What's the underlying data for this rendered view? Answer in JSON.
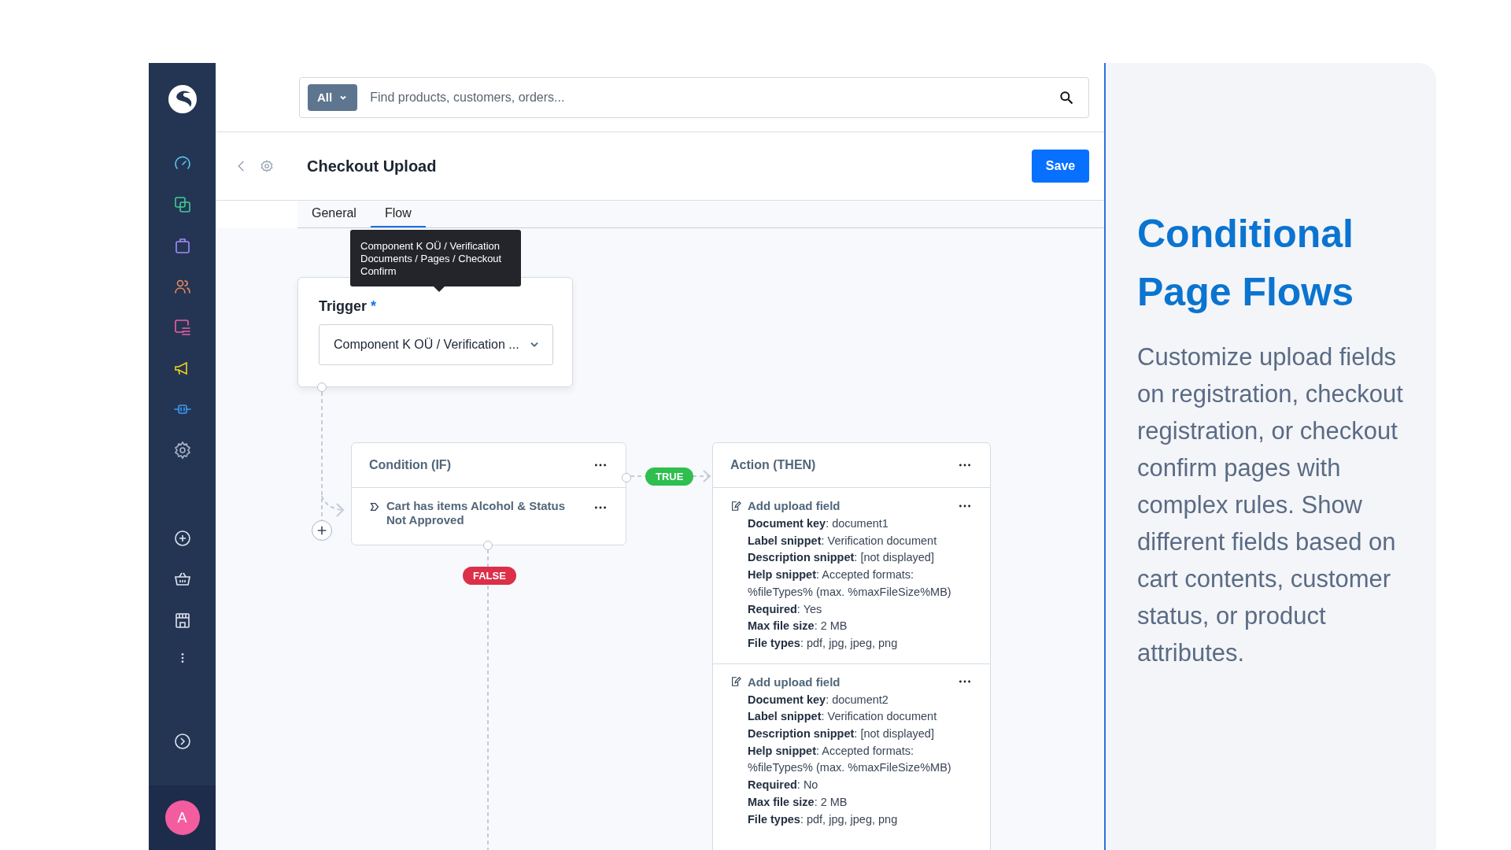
{
  "sidebar": {
    "avatar": "A"
  },
  "search": {
    "filter": "All",
    "placeholder": "Find products, customers, orders..."
  },
  "header": {
    "title": "Checkout Upload",
    "save": "Save"
  },
  "tabs": [
    {
      "label": "General",
      "selected": false
    },
    {
      "label": "Flow",
      "selected": true
    }
  ],
  "tooltip": "Component K OÜ / Verification Documents / Pages / Checkout Confirm",
  "trigger": {
    "label": "Trigger",
    "required": "*",
    "value": "Component K OÜ / Verification ..."
  },
  "condition": {
    "title": "Condition (IF)",
    "rule": "Cart has items Alcohol & Status Not Approved"
  },
  "branches": {
    "true": "TRUE",
    "false": "FALSE"
  },
  "action": {
    "title": "Action (THEN)",
    "items": [
      {
        "title": "Add upload field",
        "lines": [
          "**Document key**: document1",
          "**Label snippet**: Verification document",
          "**Description snippet**: [not displayed]",
          "**Help snippet**: Accepted formats: %fileTypes% (max. %maxFileSize%MB)",
          "**Required**: Yes",
          "**Max file size**: 2 MB",
          "**File types**: pdf, jpg, jpeg, png"
        ]
      },
      {
        "title": "Add upload field",
        "lines": [
          "**Document key**: document2",
          "**Label snippet**: Verification document",
          "**Description snippet**: [not displayed]",
          "**Help snippet**: Accepted formats: %fileTypes% (max. %maxFileSize%MB)",
          "**Required**: No",
          "**Max file size**: 2 MB",
          "**File types**: pdf, jpg, jpeg, png"
        ]
      }
    ]
  },
  "panel": {
    "heading": "Conditional Page Flows",
    "body": "Customize upload fields on registration, checkout registration, or checkout confirm pages with complex rules. Show different fields based on cart contents, customer status, or product attributes."
  }
}
